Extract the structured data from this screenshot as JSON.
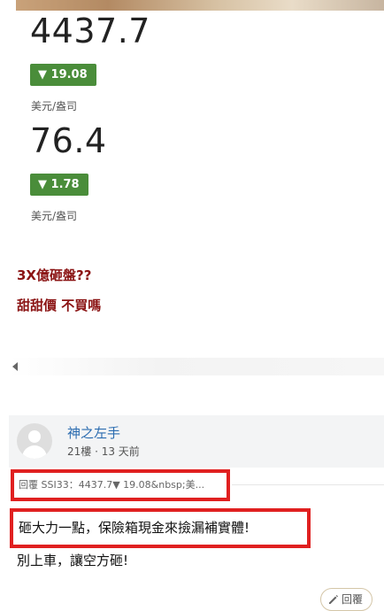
{
  "quotes": [
    {
      "price": "4437.7",
      "change": "▼ 19.08",
      "unit": "美元/盎司"
    },
    {
      "price": "76.4",
      "change": "▼ 1.78",
      "unit": "美元/盎司"
    }
  ],
  "promos": [
    "3X億砸盤??",
    "甜甜價 不買嗎"
  ],
  "comment": {
    "username": "神之左手",
    "meta": "21樓 · 13 天前",
    "reply_quote": "回覆 SSI33：4437.7▼ 19.08&nbsp;美...",
    "line1": "砸大力一點，保險箱現金來撿漏補實體!",
    "line2": "別上車，讓空方砸!",
    "reply_button": "回覆"
  },
  "colors": {
    "down_badge": "#4a8d3a",
    "promo_text": "#8b1414",
    "username": "#2b6cb0",
    "highlight_border": "#e02020"
  },
  "icons": [
    "pencil-icon",
    "avatar-placeholder-icon",
    "scroll-left-arrow-icon"
  ]
}
